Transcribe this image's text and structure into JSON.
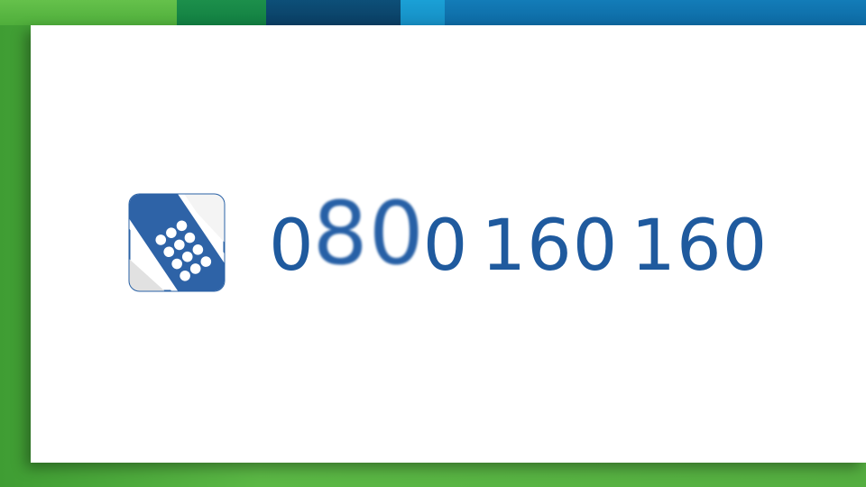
{
  "banner": {
    "phone_prefix_start": "0",
    "phone_prefix_focus": "80",
    "phone_prefix_end": "0",
    "phone_rest_1": "160",
    "phone_rest_2": "160"
  },
  "colors": {
    "background_green": "#54ae40",
    "card_white": "#ffffff",
    "number_blue": "#1f5a9e",
    "band_navy": "#0a3e63",
    "band_blue": "#0d6aa3"
  },
  "icons": {
    "logo": "phone-keypad-icon"
  }
}
